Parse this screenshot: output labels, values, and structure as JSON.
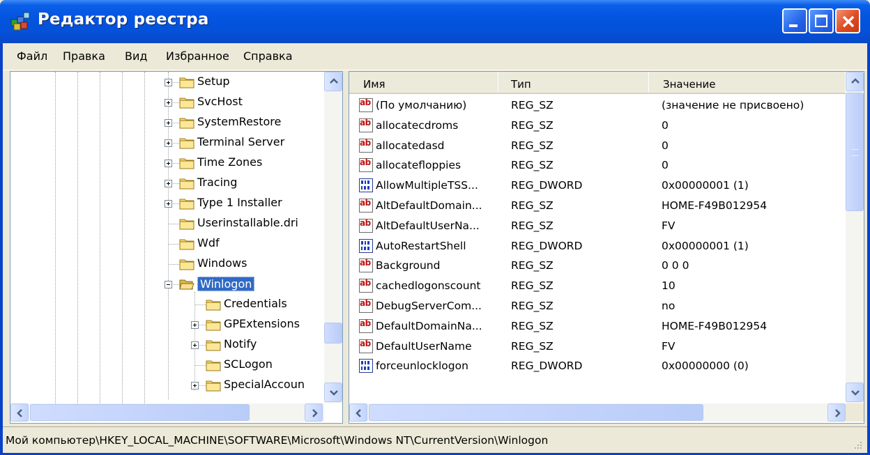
{
  "window": {
    "title": "Редактор реестра"
  },
  "menu": [
    "Файл",
    "Правка",
    "Вид",
    "Избранное",
    "Справка"
  ],
  "tree": {
    "items": [
      {
        "label": "Setup",
        "expander": "closed",
        "level": 1
      },
      {
        "label": "SvcHost",
        "expander": "closed",
        "level": 1
      },
      {
        "label": "SystemRestore",
        "expander": "closed",
        "level": 1
      },
      {
        "label": "Terminal Server",
        "expander": "closed",
        "level": 1
      },
      {
        "label": "Time Zones",
        "expander": "closed",
        "level": 1
      },
      {
        "label": "Tracing",
        "expander": "closed",
        "level": 1
      },
      {
        "label": "Type 1 Installer",
        "expander": "closed",
        "level": 1
      },
      {
        "label": "Userinstallable.dri",
        "expander": "none",
        "level": 1
      },
      {
        "label": "Wdf",
        "expander": "none",
        "level": 1
      },
      {
        "label": "Windows",
        "expander": "none",
        "level": 1
      },
      {
        "label": "Winlogon",
        "expander": "open",
        "level": 1,
        "selected": true
      },
      {
        "label": "Credentials",
        "expander": "none",
        "level": 2
      },
      {
        "label": "GPExtensions",
        "expander": "closed",
        "level": 2
      },
      {
        "label": "Notify",
        "expander": "closed",
        "level": 2
      },
      {
        "label": "SCLogon",
        "expander": "none",
        "level": 2
      },
      {
        "label": "SpecialAccoun",
        "expander": "closed",
        "level": 2
      }
    ]
  },
  "list": {
    "columns": [
      "Имя",
      "Тип",
      "Значение"
    ],
    "rows": [
      {
        "icon": "string-value-icon",
        "name": "(По умолчанию)",
        "type": "REG_SZ",
        "value": "(значение не присвоено)"
      },
      {
        "icon": "string-value-icon",
        "name": "allocatecdroms",
        "type": "REG_SZ",
        "value": "0"
      },
      {
        "icon": "string-value-icon",
        "name": "allocatedasd",
        "type": "REG_SZ",
        "value": "0"
      },
      {
        "icon": "string-value-icon",
        "name": "allocatefloppies",
        "type": "REG_SZ",
        "value": "0"
      },
      {
        "icon": "dword-value-icon",
        "name": "AllowMultipleTSS...",
        "type": "REG_DWORD",
        "value": "0x00000001 (1)"
      },
      {
        "icon": "string-value-icon",
        "name": "AltDefaultDomain...",
        "type": "REG_SZ",
        "value": "HOME-F49B012954"
      },
      {
        "icon": "string-value-icon",
        "name": "AltDefaultUserNa...",
        "type": "REG_SZ",
        "value": "FV"
      },
      {
        "icon": "dword-value-icon",
        "name": "AutoRestartShell",
        "type": "REG_DWORD",
        "value": "0x00000001 (1)"
      },
      {
        "icon": "string-value-icon",
        "name": "Background",
        "type": "REG_SZ",
        "value": "0 0 0"
      },
      {
        "icon": "string-value-icon",
        "name": "cachedlogonscount",
        "type": "REG_SZ",
        "value": "10"
      },
      {
        "icon": "string-value-icon",
        "name": "DebugServerCom...",
        "type": "REG_SZ",
        "value": "no"
      },
      {
        "icon": "string-value-icon",
        "name": "DefaultDomainNa...",
        "type": "REG_SZ",
        "value": "HOME-F49B012954"
      },
      {
        "icon": "string-value-icon",
        "name": "DefaultUserName",
        "type": "REG_SZ",
        "value": "FV"
      },
      {
        "icon": "dword-value-icon",
        "name": "forceunlocklogon",
        "type": "REG_DWORD",
        "value": "0x00000000 (0)"
      }
    ]
  },
  "status": {
    "path": "Мой компьютер\\HKEY_LOCAL_MACHINE\\SOFTWARE\\Microsoft\\Windows NT\\CurrentVersion\\Winlogon"
  },
  "colors": {
    "titlebar": "#0454e0",
    "selection": "#316ac5",
    "close": "#e04a20"
  }
}
